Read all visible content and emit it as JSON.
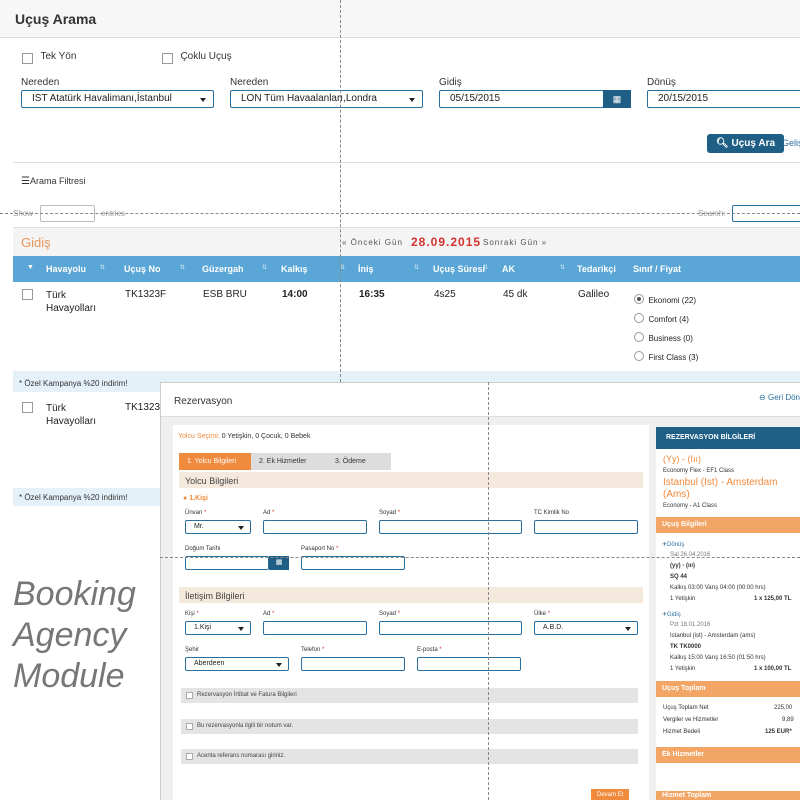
{
  "search": {
    "title": "Uçuş Arama",
    "one_way": "Tek Yön",
    "multi": "Çoklu Uçuş",
    "from_label": "Nereden",
    "from_value": "IST Atatürk Havalimanı,İstanbul",
    "to_label": "Nereden",
    "to_value": "LON Tüm Havaalanları,Londra",
    "depart_label": "Gidiş",
    "depart_value": "05/15/2015",
    "return_label": "Dönüş",
    "return_value": "20/15/2015",
    "search_button": "Uçuş Ara",
    "advanced": "Geliş",
    "filter": "Arama Filtresi",
    "show": "Show",
    "entries": "entries",
    "search_label": "Search:"
  },
  "results": {
    "section": "Gidiş",
    "prev": "« Önceki Gün",
    "date": "28.09.2015",
    "next": "Sonraki Gün »",
    "columns": [
      "Havayolu",
      "Uçuş No",
      "Güzergah",
      "Kalkış",
      "İniş",
      "Uçuş Süresi",
      "AK",
      "Tedarikçi",
      "Sınıf / Fiyat"
    ],
    "row1": {
      "airline_line1": "Türk",
      "airline_line2": "Havayolları",
      "flight": "TK1323F",
      "route": "ESB BRU",
      "dep": "14:00",
      "arr": "16:35",
      "duration": "4s25",
      "ak": "45 dk",
      "supplier": "Galileo"
    },
    "classes": [
      "Ekonomi (22)",
      "Comfort (4)",
      "Business (0)",
      "First Class (3)"
    ],
    "promo": "* Özel Kampanya %20 indirim!",
    "row2": {
      "airline_line1": "Türk",
      "airline_line2": "Havayolları",
      "flight": "TK1323"
    },
    "promo2": "* Özel Kampanya %20 indirim!"
  },
  "booking_text": [
    "Booking",
    "Agency",
    "Module"
  ],
  "reservation": {
    "title": "Rezervasyon",
    "back": "Geri Dön",
    "passenger_select_label": "Yolcu Seçimi:",
    "passenger_select_value": "0 Yetişkin, 0 Çocuk, 0 Bebek",
    "tabs": [
      "1. Yolcu Bilgileri",
      "2. Ek Hizmetler",
      "3. Ödeme"
    ],
    "passenger_section": "Yolcu Bilgileri",
    "person": "1.Kişi",
    "unvan": "Ünvan",
    "unvan_value": "Mr.",
    "ad": "Ad",
    "soyad": "Soyad",
    "tc": "TC Kimlik No",
    "dogum": "Doğum Tarihi",
    "pasaport": "Pasaport No",
    "contact_section": "İletişim Bilgileri",
    "kisi": "Kişi",
    "kisi_value": "1.Kişi",
    "ulke": "Ülke",
    "ulke_value": "A.B.D.",
    "sehir": "Şehir",
    "sehir_value": "Aberdeen",
    "telefon": "Telefon",
    "eposta": "E-posta",
    "opt1": "Rezervasyon İrtibat ve Fatura Bilgileri",
    "opt2": "Bu rezervasyonla ilgili bir notum var.",
    "opt3": "Acenta referans numarası giriniz.",
    "continue": "Devam Et"
  },
  "summary": {
    "head": "REZERVASYON BİLGİLERİ",
    "line1": "(Yy) - (Iıı)",
    "line2": "Economy Flex - EF1 Class",
    "line3": "Istanbul (Ist) - Amsterdam (Ams)",
    "line4": "Economy - A1 Class",
    "flights_head": "Uçuş Bilgileri",
    "donus": "Dönüş",
    "d_date": "Sal 26.04.2016",
    "d_route": "(yy) - (ııı)",
    "d_flight": "SQ 44",
    "d_times": "Kalkış 03:00 Varış 04:00 (00:00 hrs)",
    "d_pax": "1 Yetişkin",
    "d_price": "1 x 125,00 TL",
    "gidis": "Gidiş",
    "g_date": "Pzt 18.01.2016",
    "g_route": "Istanbul (ist) - Amsterdam (ams)",
    "g_flight": "TK TK0000",
    "g_times": "Kalkış 15:00 Varış 16:50 (01:50 hrs)",
    "g_pax": "1 Yetişkin",
    "g_price": "1 x 100,00 TL",
    "total_head": "Uçuş Toplam",
    "net_label": "Uçuş Toplam Net",
    "net_value": "225,00",
    "tax_label": "Vergiler ve Hizmetler",
    "tax_value": "9,89",
    "fee_label": "Hizmet Bedeli",
    "fee_value": "125 EUR*",
    "extra_head": "Ek Hizmetler",
    "services_head": "Hizmet Toplam"
  }
}
